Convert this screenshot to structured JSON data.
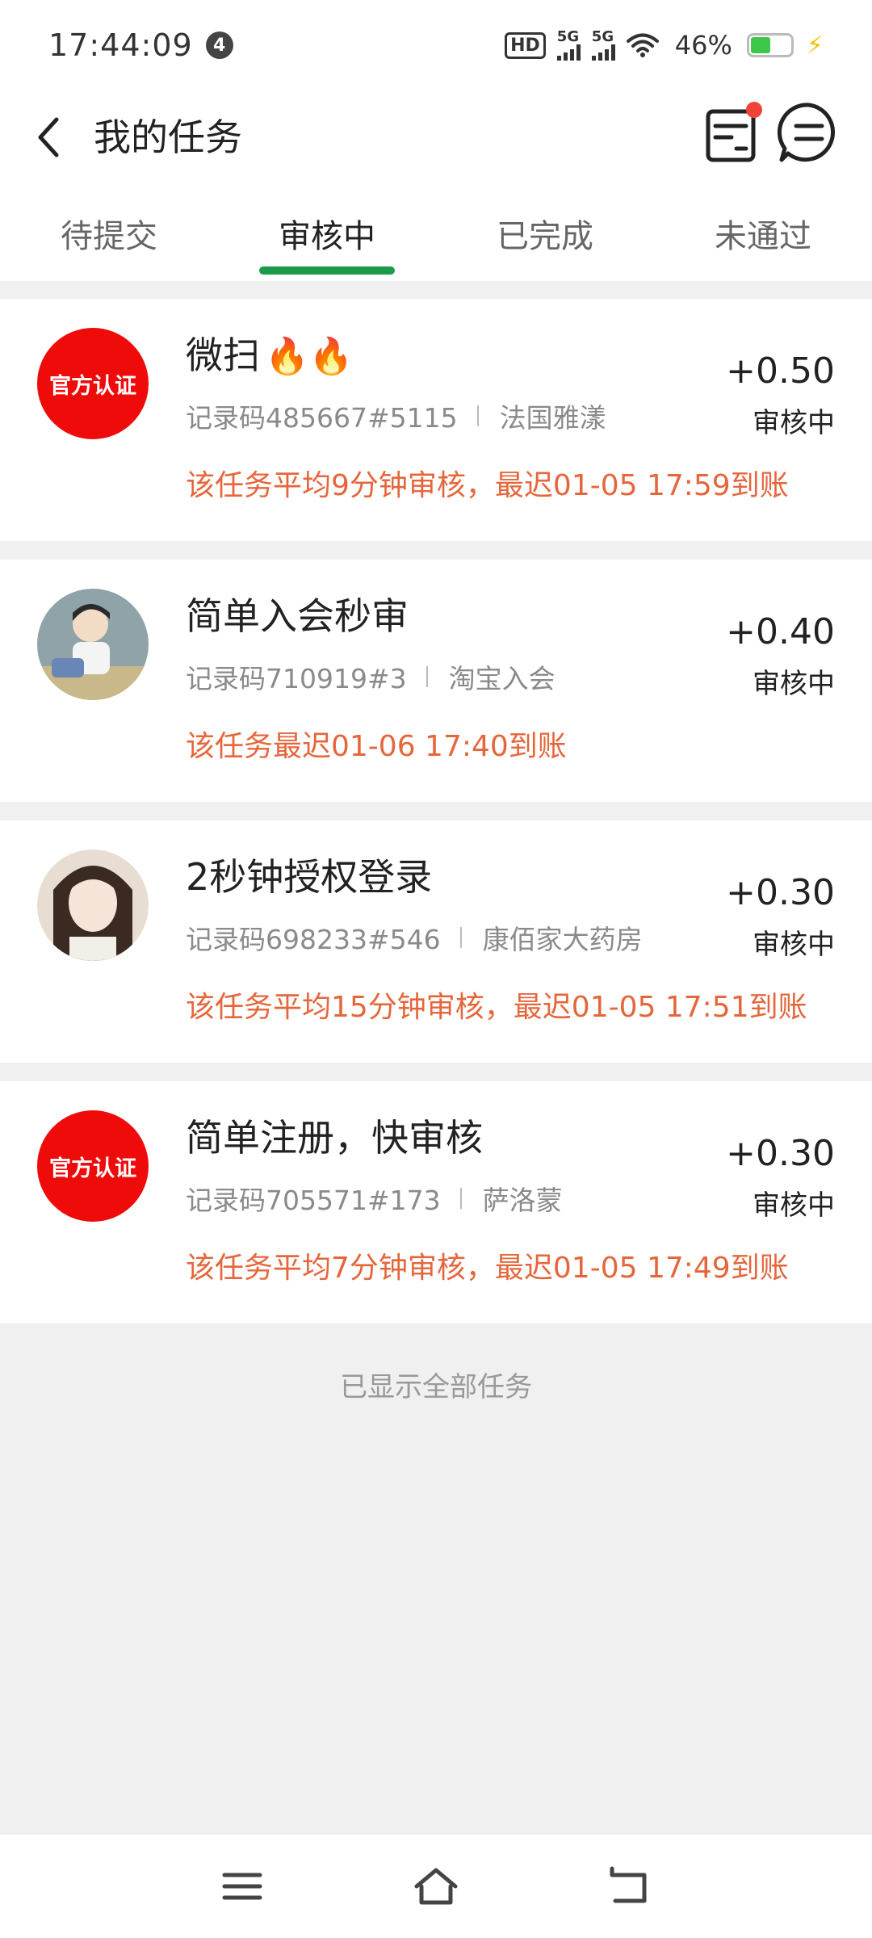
{
  "status_bar": {
    "time": "17:44:09",
    "notification_count": "4",
    "hd_label": "HD",
    "signal1_label": "5G",
    "signal2_label": "5G",
    "battery_text": "46%"
  },
  "header": {
    "title": "我的任务"
  },
  "tabs": [
    {
      "label": "待提交"
    },
    {
      "label": "审核中"
    },
    {
      "label": "已完成"
    },
    {
      "label": "未通过"
    }
  ],
  "tasks": [
    {
      "avatar_text": "官方认证",
      "title": "微扫",
      "fire": "🔥🔥",
      "record": "记录码485667#5115",
      "merchant": "法国雅漾",
      "note": "该任务平均9分钟审核，最迟01-05 17:59到账",
      "amount": "+0.50",
      "status": "审核中"
    },
    {
      "avatar_text": "",
      "title": "简单入会秒审",
      "fire": "",
      "record": "记录码710919#3",
      "merchant": "淘宝入会",
      "note": "该任务最迟01-06 17:40到账",
      "amount": "+0.40",
      "status": "审核中"
    },
    {
      "avatar_text": "",
      "title": "2秒钟授权登录",
      "fire": "",
      "record": "记录码698233#546",
      "merchant": "康佰家大药房",
      "note": "该任务平均15分钟审核，最迟01-05 17:51到账",
      "amount": "+0.30",
      "status": "审核中"
    },
    {
      "avatar_text": "官方认证",
      "title": "简单注册，快审核",
      "fire": "",
      "record": "记录码705571#173",
      "merchant": "萨洛蒙",
      "note": "该任务平均7分钟审核，最迟01-05 17:49到账",
      "amount": "+0.30",
      "status": "审核中"
    }
  ],
  "footer_text": "已显示全部任务",
  "colors": {
    "accent_green": "#1b9a4b",
    "note_orange": "#e6663c",
    "official_red": "#f00b0b",
    "badge_red": "#f0443a"
  },
  "icons": [
    "back-icon",
    "order-list-icon",
    "chat-icon",
    "menu-icon",
    "home-icon",
    "back-nav-icon"
  ]
}
